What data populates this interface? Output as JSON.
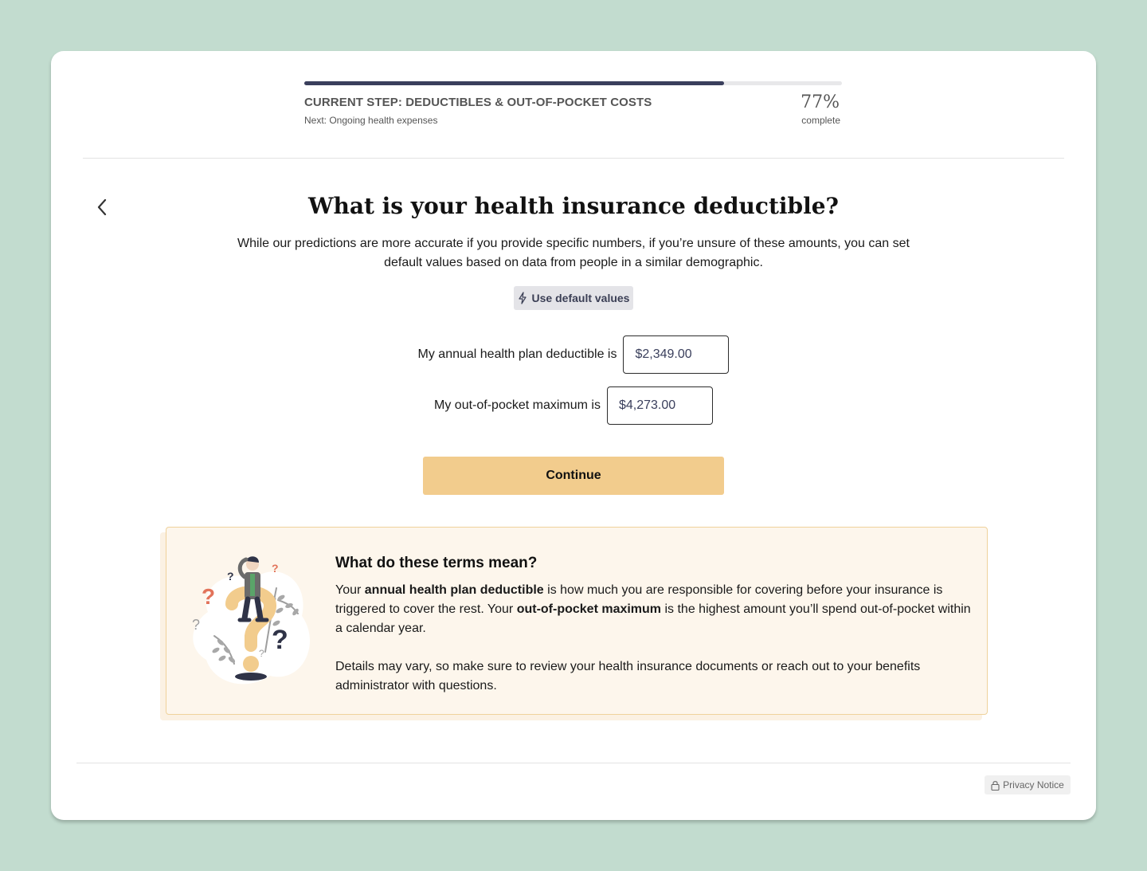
{
  "progress": {
    "step_title": "CURRENT STEP: DEDUCTIBLES & OUT-OF-POCKET COSTS",
    "next_step": "Next: Ongoing health expenses",
    "percent_text": "77%",
    "percent_label": "complete",
    "fraction": 0.78
  },
  "question": {
    "title": "What is your health insurance deductible?",
    "intro": "While our predictions are more accurate if you provide specific numbers, if you’re unsure of these amounts, you can set default values based on data from people in a similar demographic."
  },
  "default_button": {
    "label": "Use default values",
    "icon": "lightning-icon"
  },
  "form": {
    "deductible_label": "My annual health plan deductible is",
    "deductible_value": "$2,349.00",
    "oop_label": "My out-of-pocket maximum is",
    "oop_value": "$4,273.00"
  },
  "continue_label": "Continue",
  "info": {
    "title": "What do these terms mean?",
    "p1_a": "Your ",
    "p1_b": "annual health plan deductible",
    "p1_c": " is how much you are responsible for covering before your insurance is triggered to cover the rest. Your ",
    "p1_d": "out-of-pocket maximum",
    "p1_e": " is the highest amount you’ll spend out-of-pocket within a calendar year.",
    "p2": "Details may vary, so make sure to review your health insurance documents or reach out to your benefits administrator with questions."
  },
  "footer": {
    "privacy_label": "Privacy Notice",
    "icon": "lock-icon"
  },
  "colors": {
    "background": "#c2dccf",
    "progress_fill": "#3a3f5c",
    "continue": "#f2cc8d",
    "info_bg": "#fdf6ec",
    "info_border": "#efd29b"
  }
}
